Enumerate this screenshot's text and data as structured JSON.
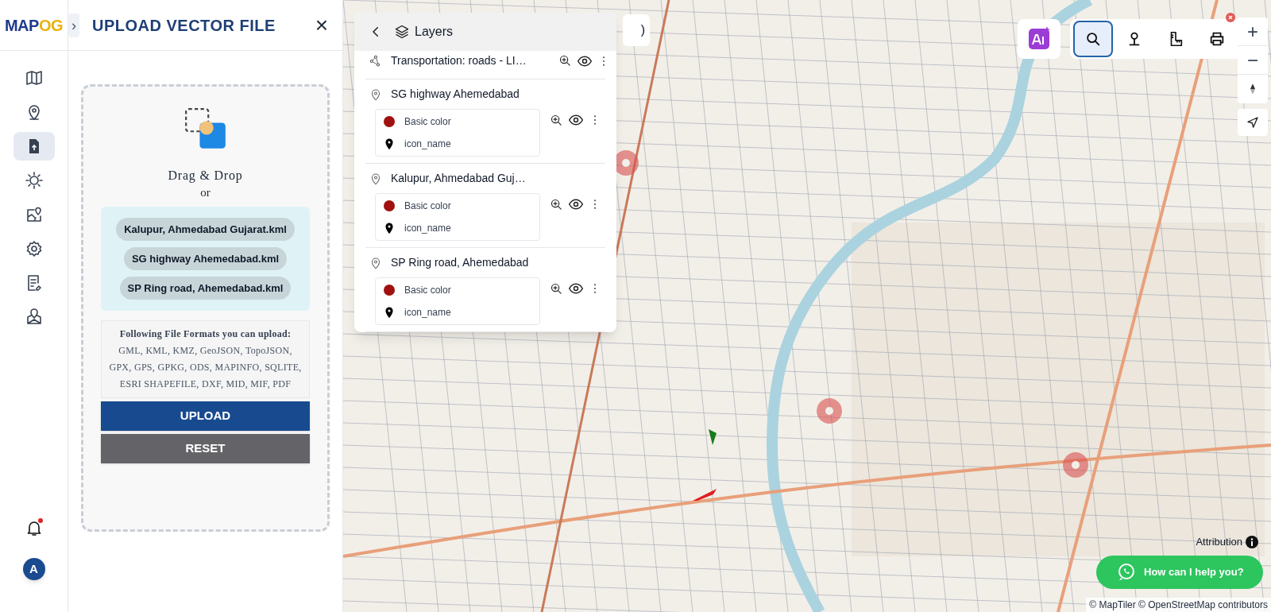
{
  "logo": {
    "part_1": "MAP",
    "part_2": "OG"
  },
  "sidebar": {
    "items": [
      {
        "kind": "map",
        "selected": false
      },
      {
        "kind": "pin",
        "selected": false
      },
      {
        "kind": "upload",
        "selected": true
      },
      {
        "kind": "sun",
        "selected": false
      },
      {
        "kind": "map-pin",
        "selected": false
      },
      {
        "kind": "gear",
        "selected": false
      },
      {
        "kind": "list",
        "selected": false
      },
      {
        "kind": "location",
        "selected": false
      }
    ],
    "notifications": {
      "unread": true
    },
    "avatar": "A"
  },
  "panel": {
    "expand": "›",
    "title": "UPLOAD VECTOR FILE",
    "close": "×",
    "drop_zone": {
      "drag_text": "Drag & Drop",
      "or_text": "or",
      "files": [
        "Kalupur, Ahmedabad Gujarat.kml",
        "SG highway Ahemedabad.kml",
        "SP Ring road, Ahemedabad.kml"
      ]
    },
    "formats": {
      "heading": "Following File Formats you can upload:",
      "list": "GML, KML, KMZ, GeoJSON, TopoJSON, GPX, GPS, GPKG, ODS, MAPINFO, SQLITE, ESRI SHAPEFILE, DXF, MID, MIF, PDF"
    },
    "buttons": [
      {
        "label": "UPLOAD",
        "kind": "primary"
      },
      {
        "label": "RESET",
        "kind": "secondary"
      }
    ]
  },
  "layers": {
    "title": "Layers",
    "items": [
      {
        "kind": "line",
        "name": "Transportation: roads - LI…"
      },
      {
        "kind": "point",
        "name": "SG highway Ahemedabad",
        "style": {
          "color": "#a01010",
          "color_label": "Basic color",
          "icon_label": "icon_name"
        }
      },
      {
        "kind": "point",
        "name": "Kalupur, Ahmedabad Guj…",
        "style": {
          "color": "#a01010",
          "color_label": "Basic color",
          "icon_label": "icon_name"
        }
      },
      {
        "kind": "point",
        "name": "SP Ring road, Ahemedabad",
        "style": {
          "color": "#a01010",
          "color_label": "Basic color",
          "icon_label": "icon_name"
        }
      }
    ]
  },
  "toggle_button": {
    "text": ")"
  },
  "toolbar": {
    "tools": [
      {
        "kind": "search",
        "selected": true
      },
      {
        "kind": "pin",
        "selected": false
      },
      {
        "kind": "ruler",
        "selected": false
      },
      {
        "kind": "print",
        "selected": false
      }
    ]
  },
  "map_controls": {
    "zoom_in": "+",
    "zoom_out": "−"
  },
  "attribution": "Attribution",
  "chat": {
    "label": "How can I help you?"
  },
  "footer": "© MapTiler © OpenStreetMap contributors"
}
